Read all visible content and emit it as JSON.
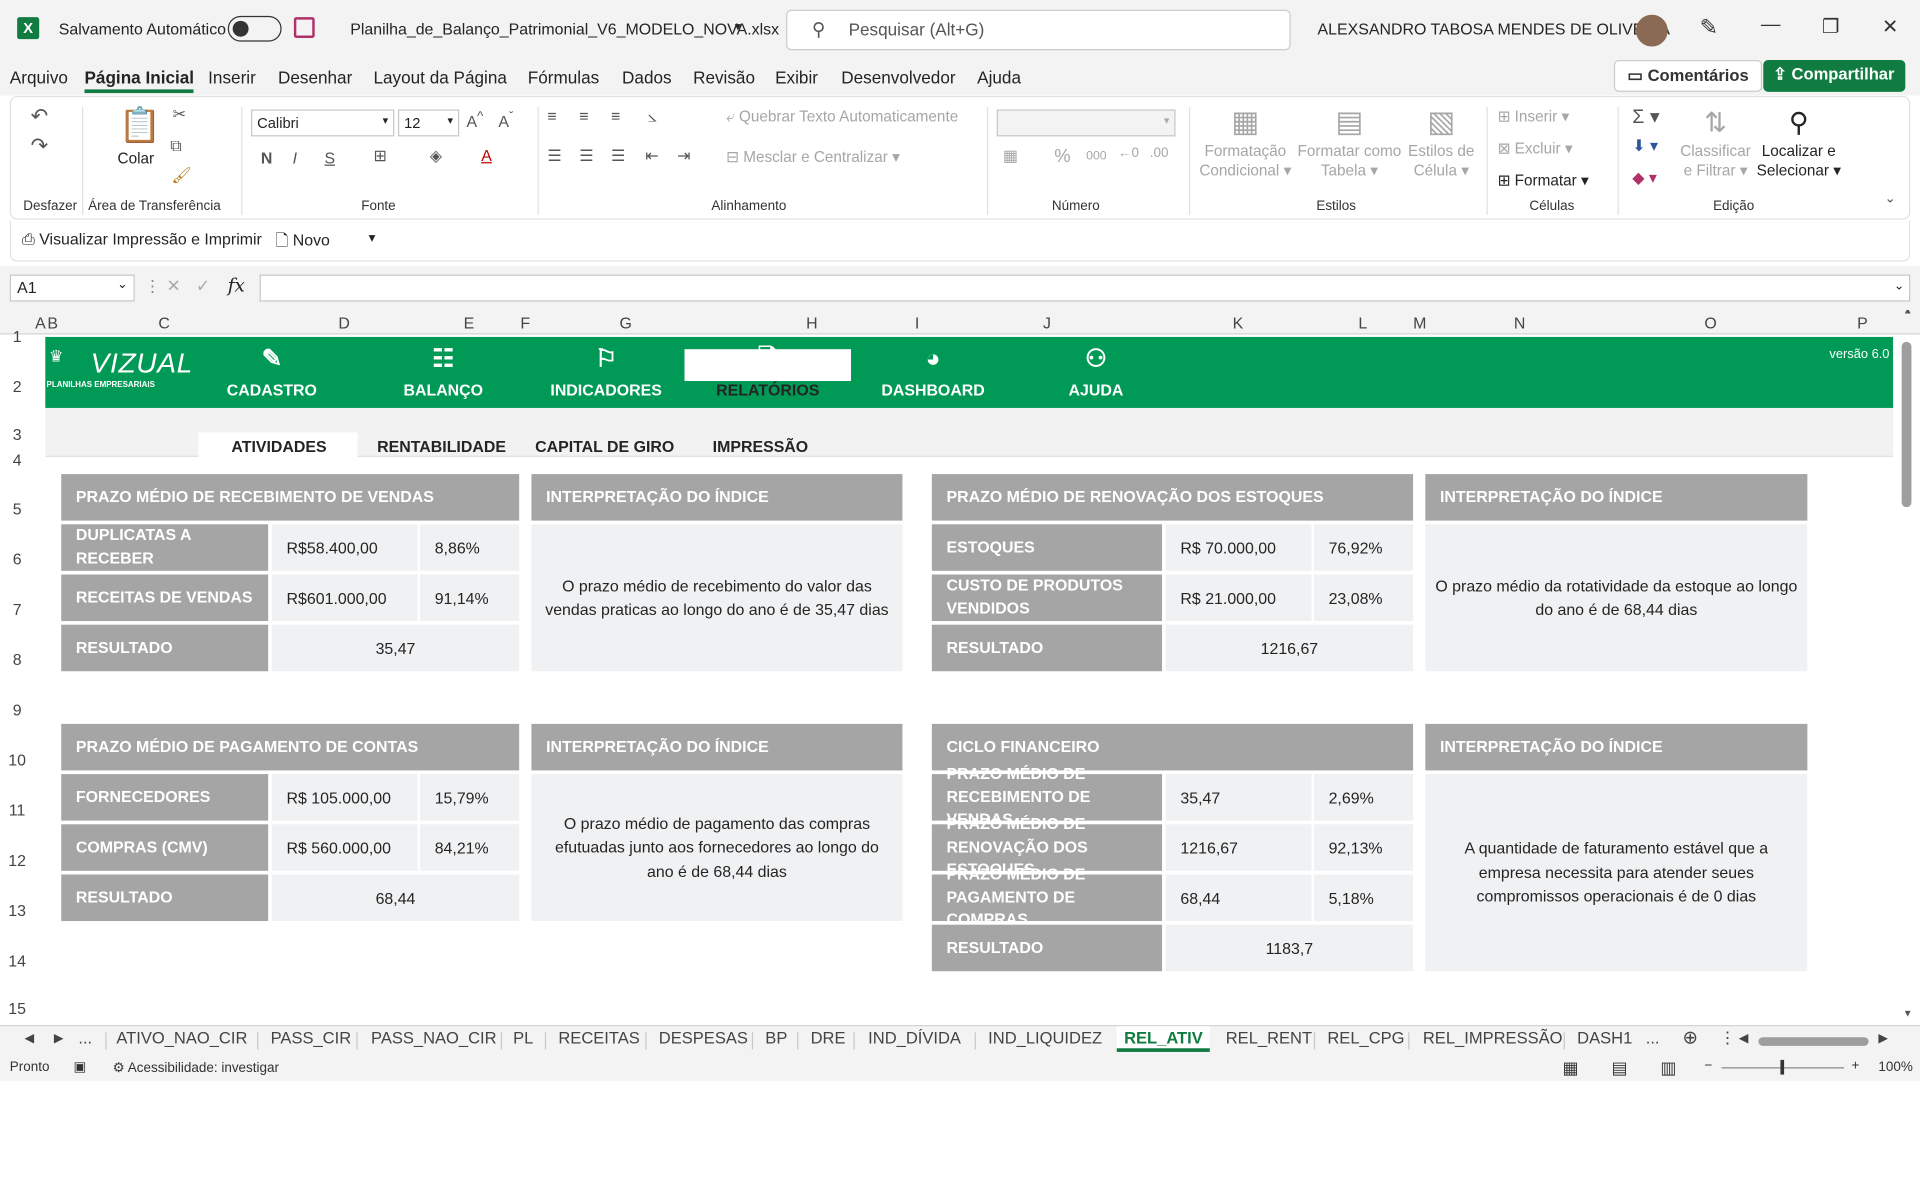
{
  "titlebar": {
    "autosave_label": "Salvamento Automático",
    "filename": "Planilha_de_Balanço_Patrimonial_V6_MODELO_NOVA.xlsx",
    "search_placeholder": "Pesquisar (Alt+G)",
    "user_name": "ALEXSANDRO TABOSA MENDES DE OLIVEIRA"
  },
  "menu": {
    "items": [
      "Arquivo",
      "Página Inicial",
      "Inserir",
      "Desenhar",
      "Layout da Página",
      "Fórmulas",
      "Dados",
      "Revisão",
      "Exibir",
      "Desenvolvedor",
      "Ajuda"
    ],
    "comments": "Comentários",
    "share": "Compartilhar"
  },
  "ribbon": {
    "undo_group": "Desfazer",
    "paste": "Colar",
    "clipboard_group": "Área de Transferência",
    "font_name": "Calibri",
    "font_size": "12",
    "font_group": "Fonte",
    "bold": "N",
    "italic": "I",
    "underline": "S",
    "wrap_text": "Quebrar Texto Automaticamente",
    "merge_center": "Mesclar e Centralizar",
    "alignment_group": "Alinhamento",
    "number_group": "Número",
    "conditional_format": [
      "Formatação",
      "Condicional"
    ],
    "format_table": [
      "Formatar como",
      "Tabela"
    ],
    "cell_styles": [
      "Estilos de",
      "Célula"
    ],
    "styles_group": "Estilos",
    "insert": "Inserir",
    "delete": "Excluir",
    "format": "Formatar",
    "cells_group": "Células",
    "sort_filter": [
      "Classificar",
      "e Filtrar"
    ],
    "find_select": [
      "Localizar e",
      "Selecionar"
    ],
    "editing_group": "Edição"
  },
  "qat": {
    "print_preview": "Visualizar Impressão e Imprimir",
    "new": "Novo"
  },
  "formula_bar": {
    "name_box": "A1",
    "fx": "fx",
    "formula": ""
  },
  "columns": [
    "A",
    "B",
    "C",
    "D",
    "E",
    "F",
    "G",
    "H",
    "I",
    "J",
    "K",
    "L",
    "M",
    "N",
    "O",
    "P"
  ],
  "rows": [
    "1",
    "2",
    "3",
    "4",
    "5",
    "6",
    "7",
    "8",
    "9",
    "10",
    "11",
    "12",
    "13",
    "14",
    "15"
  ],
  "app_nav": {
    "logo": "VIZUAL",
    "logo_sub": "PLANILHAS EMPRESARIAIS",
    "version": "versão 6.0",
    "items": [
      "CADASTRO",
      "BALANÇO",
      "INDICADORES",
      "RELATÓRIOS",
      "DASHBOARD",
      "AJUDA"
    ],
    "subtabs": [
      "ATIVIDADES",
      "RENTABILIDADE",
      "CAPITAL DE GIRO",
      "IMPRESSÃO"
    ]
  },
  "panel1": {
    "title": "PRAZO MÉDIO DE RECEBIMENTO DE VENDAS",
    "rows": [
      {
        "label": "DUPLICATAS A RECEBER",
        "value": "R$58.400,00",
        "pct": "8,86%"
      },
      {
        "label": "RECEITAS DE VENDAS",
        "value": "R$601.000,00",
        "pct": "91,14%"
      }
    ],
    "result_label": "RESULTADO",
    "result": "35,47",
    "interp_title": "INTERPRETAÇÃO DO ÍNDICE",
    "interp_text": "O prazo médio de recebimento do valor das vendas praticas ao longo do ano é de 35,47 dias"
  },
  "panel2": {
    "title": "PRAZO MÉDIO DE RENOVAÇÃO DOS ESTOQUES",
    "rows": [
      {
        "label": "ESTOQUES",
        "value": "R$ 70.000,00",
        "pct": "76,92%"
      },
      {
        "label": "CUSTO DE PRODUTOS VENDIDOS",
        "value": "R$ 21.000,00",
        "pct": "23,08%"
      }
    ],
    "result_label": "RESULTADO",
    "result": "1216,67",
    "interp_title": "INTERPRETAÇÃO DO ÍNDICE",
    "interp_text": "O prazo médio da rotatividade da estoque ao longo do ano é de 68,44 dias"
  },
  "panel3": {
    "title": "PRAZO MÉDIO DE PAGAMENTO DE CONTAS",
    "rows": [
      {
        "label": "FORNECEDORES",
        "value": "R$ 105.000,00",
        "pct": "15,79%"
      },
      {
        "label": "COMPRAS (CMV)",
        "value": "R$ 560.000,00",
        "pct": "84,21%"
      }
    ],
    "result_label": "RESULTADO",
    "result": "68,44",
    "interp_title": "INTERPRETAÇÃO DO ÍNDICE",
    "interp_text": "O prazo médio de pagamento das compras efutuadas junto aos fornecedores ao longo do ano é de 68,44 dias"
  },
  "panel4": {
    "title": "CICLO FINANCEIRO",
    "rows": [
      {
        "label": "PRAZO MÉDIO DE RECEBIMENTO DE VENDAS",
        "value": "35,47",
        "pct": "2,69%"
      },
      {
        "label": "PRAZO MÉDIO DE RENOVAÇÃO DOS ESTOQUES",
        "value": "1216,67",
        "pct": "92,13%"
      },
      {
        "label": "PRAZO MÉDIO DE PAGAMENTO DE COMPRAS",
        "value": "68,44",
        "pct": "5,18%"
      }
    ],
    "result_label": "RESULTADO",
    "result": "1183,7",
    "interp_title": "INTERPRETAÇÃO DO ÍNDICE",
    "interp_text": "A quantidade de faturamento estável que a empresa necessita para atender seues compromissos operacionais é de 0 dias"
  },
  "sheet_tabs": [
    "...",
    "ATIVO_NAO_CIR",
    "PASS_CIR",
    "PASS_NAO_CIR",
    "PL",
    "RECEITAS",
    "DESPESAS",
    "BP",
    "DRE",
    "IND_DÍVIDA",
    "IND_LIQUIDEZ",
    "REL_ATIV",
    "REL_RENT",
    "REL_CPG",
    "REL_IMPRESSÃO",
    "DASH1",
    "..."
  ],
  "active_tab": "REL_ATIV",
  "status": {
    "ready": "Pronto",
    "accessibility": "Acessibilidade: investigar",
    "zoom": "100%"
  },
  "colors": {
    "brand_green": "#009a56",
    "excel_green": "#107c41",
    "panel_gray": "#a5a5a5",
    "panel_light": "#eff1f3"
  }
}
